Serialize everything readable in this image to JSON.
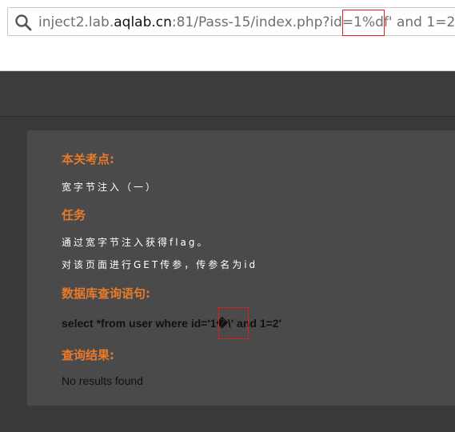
{
  "browser": {
    "url_prefix": "inject2.lab.",
    "url_host_bold": "aqlab.cn",
    "url_suffix": ":81/Pass-15/index.php?id=1%df' and 1=2",
    "search_icon": "search-icon"
  },
  "panel": {
    "section1_title": "本关考点:",
    "section1_text": "宽字节注入（一）",
    "section2_title": "任务",
    "section2_line1": "通过宽字节注入获得flag。",
    "section2_line2": "对该页面进行GET传参，传参名为id",
    "section3_title": "数据库查询语句:",
    "query": "select *from user where id='1�\\' and 1=2'",
    "section4_title": "查询结果:",
    "result": "No results found"
  },
  "colors": {
    "heading": "#e87a2a",
    "highlight_box": "#e02020",
    "panel_bg": "#4a4a4a",
    "page_bg": "#3a3a3a"
  }
}
